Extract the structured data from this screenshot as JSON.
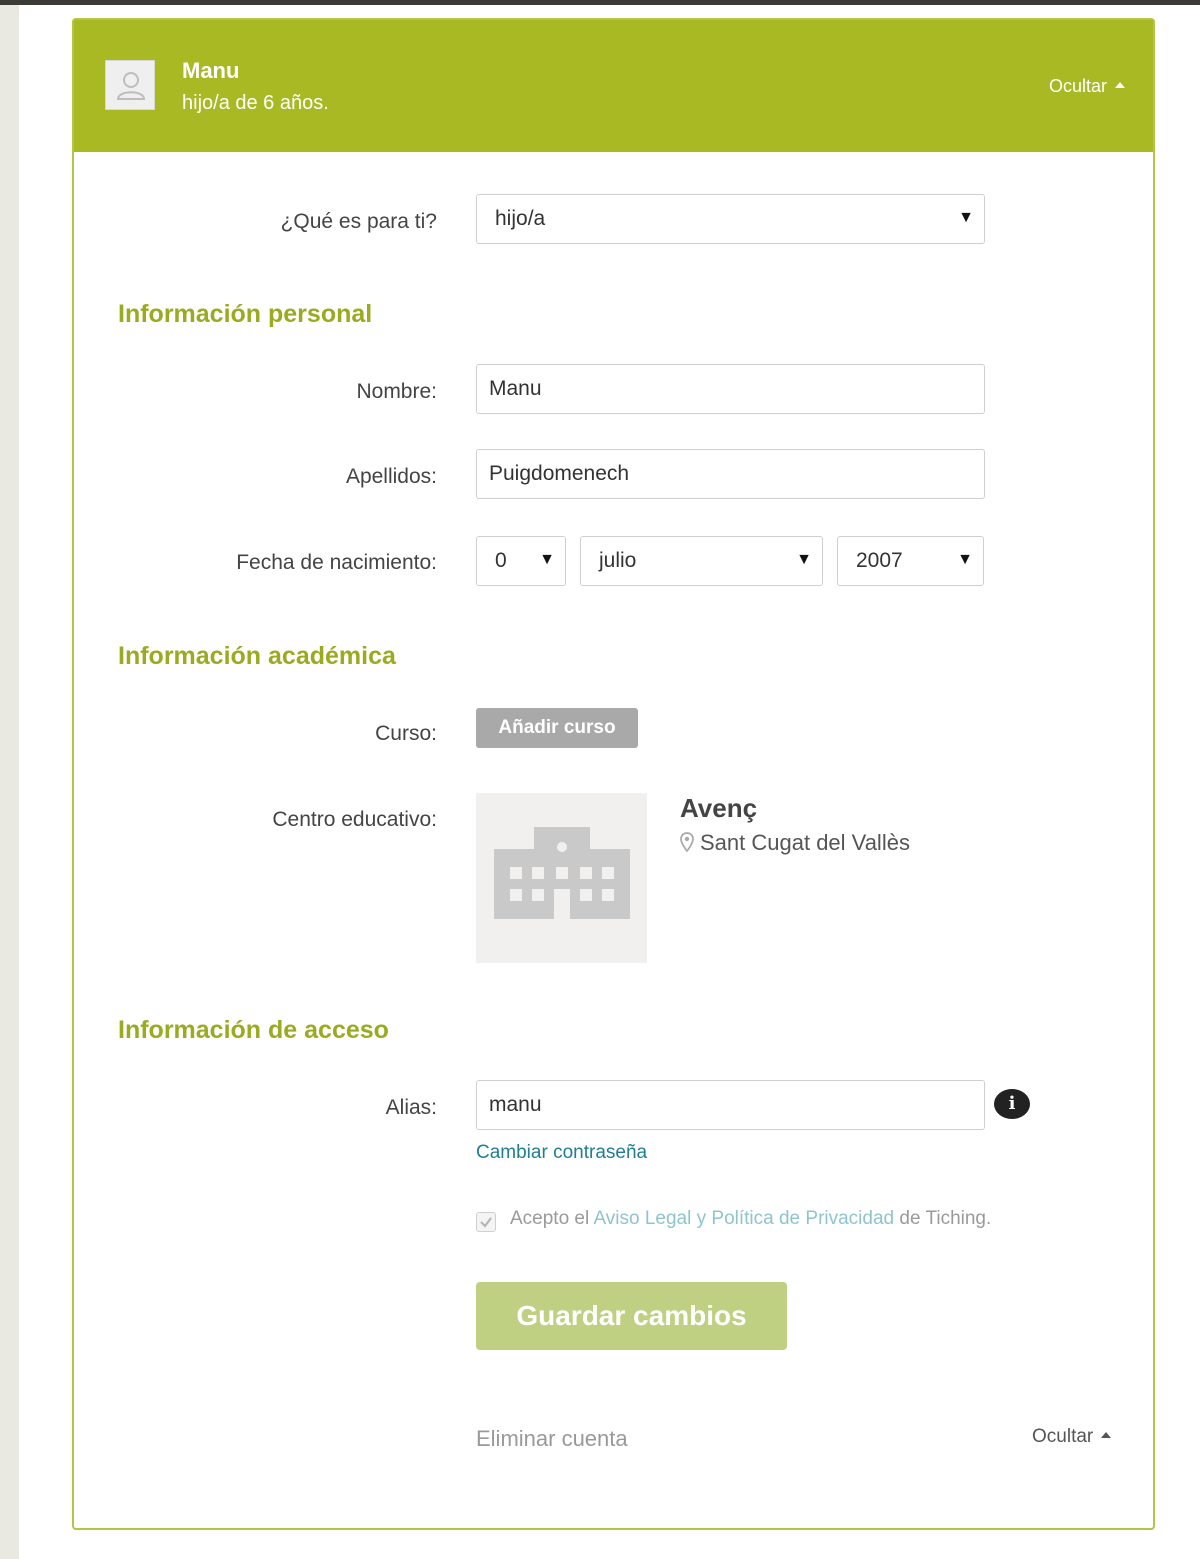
{
  "header": {
    "child_name": "Manu",
    "child_subtitle": "hijo/a de 6 años.",
    "hide_label": "Ocultar"
  },
  "relation": {
    "label": "¿Qué es para ti?",
    "value": "hijo/a"
  },
  "personal": {
    "title": "Información personal",
    "first_name_label": "Nombre:",
    "first_name_value": "Manu",
    "last_name_label": "Apellidos:",
    "last_name_value": "Puigdomenech",
    "birth_label": "Fecha de nacimiento:",
    "birth_day": "0",
    "birth_month": "julio",
    "birth_year": "2007"
  },
  "academic": {
    "title": "Información académica",
    "course_label": "Curso:",
    "add_course_label": "Añadir curso",
    "school_label": "Centro educativo:",
    "school_name": "Avenç",
    "school_location": "Sant Cugat del Vallès"
  },
  "access": {
    "title": "Información de acceso",
    "alias_label": "Alias:",
    "alias_value": "manu",
    "info_icon_glyph": "i",
    "change_password": "Cambiar contraseña",
    "accept_prefix": "Acepto el ",
    "accept_link": "Aviso Legal y Política de Privacidad",
    "accept_suffix": " de Tiching.",
    "terms_checked": true
  },
  "actions": {
    "save": "Guardar cambios",
    "delete": "Eliminar cuenta",
    "hide": "Ocultar"
  },
  "colors": {
    "accent": "#a8b924",
    "section_title": "#9aab22",
    "save_button": "#bfd083",
    "link": "#1f7e93"
  },
  "icons": {
    "avatar": "user-silhouette-icon",
    "school": "school-building-icon",
    "location": "map-pin-icon",
    "info": "info-icon",
    "checkbox": "checkmark-icon"
  }
}
